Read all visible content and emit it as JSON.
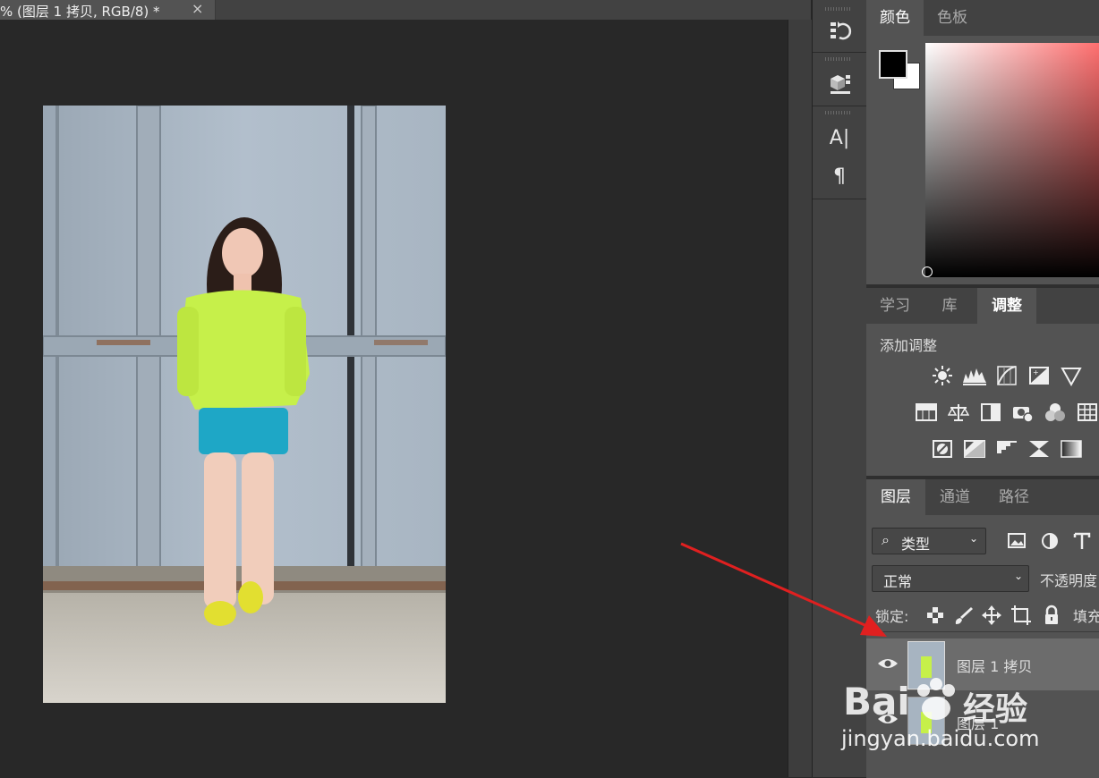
{
  "document": {
    "tab_title": "% (图层 1 拷贝, RGB/8) *",
    "close_glyph": "×"
  },
  "toolstrip": {
    "icons": [
      "history-icon",
      "3d-icon",
      "character-icon",
      "paragraph-icon"
    ],
    "character_glyph": "A|",
    "paragraph_glyph": "¶"
  },
  "color_panel": {
    "tabs": [
      "颜色",
      "色板"
    ],
    "active_tab": "颜色",
    "foreground": "#000000",
    "background": "#ffffff",
    "hue_color": "#ff6f6f"
  },
  "adjust_panel": {
    "tabs": [
      "学习",
      "库",
      "调整"
    ],
    "active_tab": "调整",
    "title": "添加调整",
    "rows": [
      [
        "brightness-contrast-icon",
        "levels-icon",
        "curves-icon",
        "exposure-icon",
        "vibrance-icon"
      ],
      [
        "hue-saturation-icon",
        "color-balance-icon",
        "black-white-icon",
        "photo-filter-icon",
        "channel-mixer-icon",
        "color-lookup-icon"
      ],
      [
        "invert-icon",
        "posterize-icon",
        "threshold-icon",
        "selective-color-icon",
        "gradient-map-icon"
      ]
    ]
  },
  "layers_panel": {
    "tabs": [
      "图层",
      "通道",
      "路径"
    ],
    "active_tab": "图层",
    "filter_label": "类型",
    "blend_mode": "正常",
    "opacity_label": "不透明度",
    "lock_label": "锁定:",
    "fill_label": "填充",
    "layers": [
      {
        "name": "图层 1 拷贝",
        "visible": true,
        "selected": true
      },
      {
        "name": "图层 1",
        "visible": true,
        "selected": false
      }
    ]
  },
  "watermark": {
    "brand": "Bai",
    "brand_cn": "经验",
    "url": "jingyan.baidu.com"
  },
  "colors": {
    "arrow": "#e02020",
    "panel_bg": "#535353",
    "tab_bg": "#424242",
    "canvas_bg": "#282828"
  }
}
